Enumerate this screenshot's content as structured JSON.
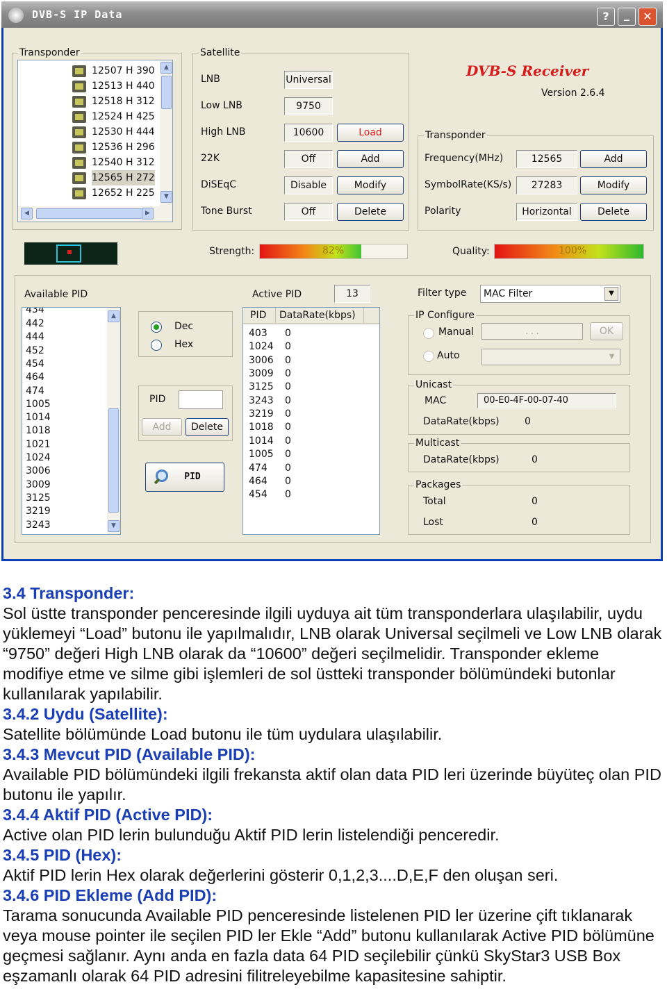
{
  "window": {
    "title": "DVB-S IP Data",
    "help_btn": "?",
    "min_btn": "_",
    "close_btn": "✕"
  },
  "brand": {
    "name": "DVB-S Receiver",
    "version": "Version 2.6.4",
    "color": "#d61b1b"
  },
  "transponder_list": {
    "caption": "Transponder",
    "items": [
      "12507 H 390",
      "12513 H 440",
      "12518 H 312",
      "12524 H 425",
      "12530 H 444",
      "12536 H 296",
      "12540 H 312",
      "12565 H 272",
      "12652 H 225"
    ],
    "selected_index": 7
  },
  "satellite": {
    "caption": "Satellite",
    "rows": [
      {
        "label": "LNB",
        "value": "Universal",
        "button": ""
      },
      {
        "label": "Low LNB",
        "value": "9750",
        "button": ""
      },
      {
        "label": "High LNB",
        "value": "10600",
        "button": "Load"
      },
      {
        "label": "22K",
        "value": "Off",
        "button": "Add"
      },
      {
        "label": "DiSEqC",
        "value": "Disable",
        "button": "Modify"
      },
      {
        "label": "Tone Burst",
        "value": "Off",
        "button": "Delete"
      }
    ]
  },
  "transponder": {
    "caption": "Transponder",
    "rows": [
      {
        "label": "Frequency(MHz)",
        "value": "12565",
        "button": "Add"
      },
      {
        "label": "SymbolRate(KS/s)",
        "value": "27283",
        "button": "Modify"
      },
      {
        "label": "Polarity",
        "value": "Horizontal",
        "button": "Delete"
      }
    ]
  },
  "signal": {
    "strength_label": "Strength:",
    "strength_value": "82%",
    "strength_pct": 82,
    "quality_label": "Quality:",
    "quality_value": "100%",
    "quality_pct": 100
  },
  "available_pid": {
    "caption": "Available PID",
    "partial_top": "434",
    "items": [
      "442",
      "444",
      "452",
      "454",
      "464",
      "474",
      "1005",
      "1014",
      "1018",
      "1021",
      "1024",
      "3006",
      "3009",
      "3125",
      "3219",
      "3243"
    ]
  },
  "format": {
    "dec": "Dec",
    "hex": "Hex",
    "selected": "dec"
  },
  "pid_entry": {
    "label": "PID",
    "value": "",
    "add": "Add",
    "delete": "Delete"
  },
  "pid_button": {
    "label": "PID"
  },
  "active_pid": {
    "caption": "Active PID",
    "count": "13",
    "col_pid": "PID",
    "col_rate": "DataRate(kbps)",
    "rows": [
      {
        "pid": "403",
        "rate": "0"
      },
      {
        "pid": "1024",
        "rate": "0"
      },
      {
        "pid": "3006",
        "rate": "0"
      },
      {
        "pid": "3009",
        "rate": "0"
      },
      {
        "pid": "3125",
        "rate": "0"
      },
      {
        "pid": "3243",
        "rate": "0"
      },
      {
        "pid": "3219",
        "rate": "0"
      },
      {
        "pid": "1018",
        "rate": "0"
      },
      {
        "pid": "1014",
        "rate": "0"
      },
      {
        "pid": "1005",
        "rate": "0"
      },
      {
        "pid": "474",
        "rate": "0"
      },
      {
        "pid": "464",
        "rate": "0"
      },
      {
        "pid": "454",
        "rate": "0"
      }
    ]
  },
  "filter": {
    "label": "Filter type",
    "value": "MAC Filter"
  },
  "ip_config": {
    "caption": "IP Configure",
    "manual": "Manual",
    "auto": "Auto",
    "ip_placeholder": ".   .   .",
    "ok": "OK"
  },
  "unicast": {
    "caption": "Unicast",
    "mac_label": "MAC",
    "mac_value": "00-E0-4F-00-07-40",
    "rate_label": "DataRate(kbps)",
    "rate_value": "0"
  },
  "multicast": {
    "caption": "Multicast",
    "rate_label": "DataRate(kbps)",
    "rate_value": "0"
  },
  "packages": {
    "caption": "Packages",
    "total_label": "Total",
    "total_value": "0",
    "lost_label": "Lost",
    "lost_value": "0"
  },
  "doc": {
    "h1": "3.4 Transponder:",
    "p1": "Sol üstte transponder penceresinde ilgili uyduya ait tüm transponderlara ulaşılabilir, uydu yüklemeyi “Load” butonu ile yapılmalıdır, LNB olarak Universal seçilmeli ve Low LNB olarak “9750” değeri High LNB olarak da “10600” değeri seçilmelidir. Transponder ekleme modifiye etme ve silme gibi işlemleri de sol üstteki transponder bölümündeki butonlar kullanılarak yapılabilir.",
    "h2": "3.4.2 Uydu (Satellite):",
    "p2": "Satellite bölümünde Load butonu ile tüm uydulara ulaşılabilir.",
    "h3": "3.4.3 Mevcut PID (Available PID):",
    "p3": "Available PID bölümündeki ilgili frekansta aktif olan data PID leri üzerinde büyüteç olan PID butonu ile yapılır.",
    "h4": "3.4.4 Aktif PID (Active PID):",
    "p4": "Active olan PID lerin bulunduğu Aktif PID lerin listelendiği penceredir.",
    "h5": "3.4.5 PID (Hex):",
    "p5": "Aktif PID lerin Hex olarak değerlerini gösterir 0,1,2,3....D,E,F den oluşan seri.",
    "h6": "3.4.6 PID Ekleme (Add PID):",
    "p6": "Tarama sonucunda Available PID penceresinde listelenen PID ler üzerine çift tıklanarak veya mouse pointer ile seçilen PID ler Ekle “Add” butonu kullanılarak Active PID bölümüne geçmesi sağlanır. Aynı anda en fazla data 64 PID seçilebilir çünkü SkyStar3 USB Box eşzamanlı olarak 64 PID adresini filitreleyebilme kapasitesine sahiptir."
  }
}
